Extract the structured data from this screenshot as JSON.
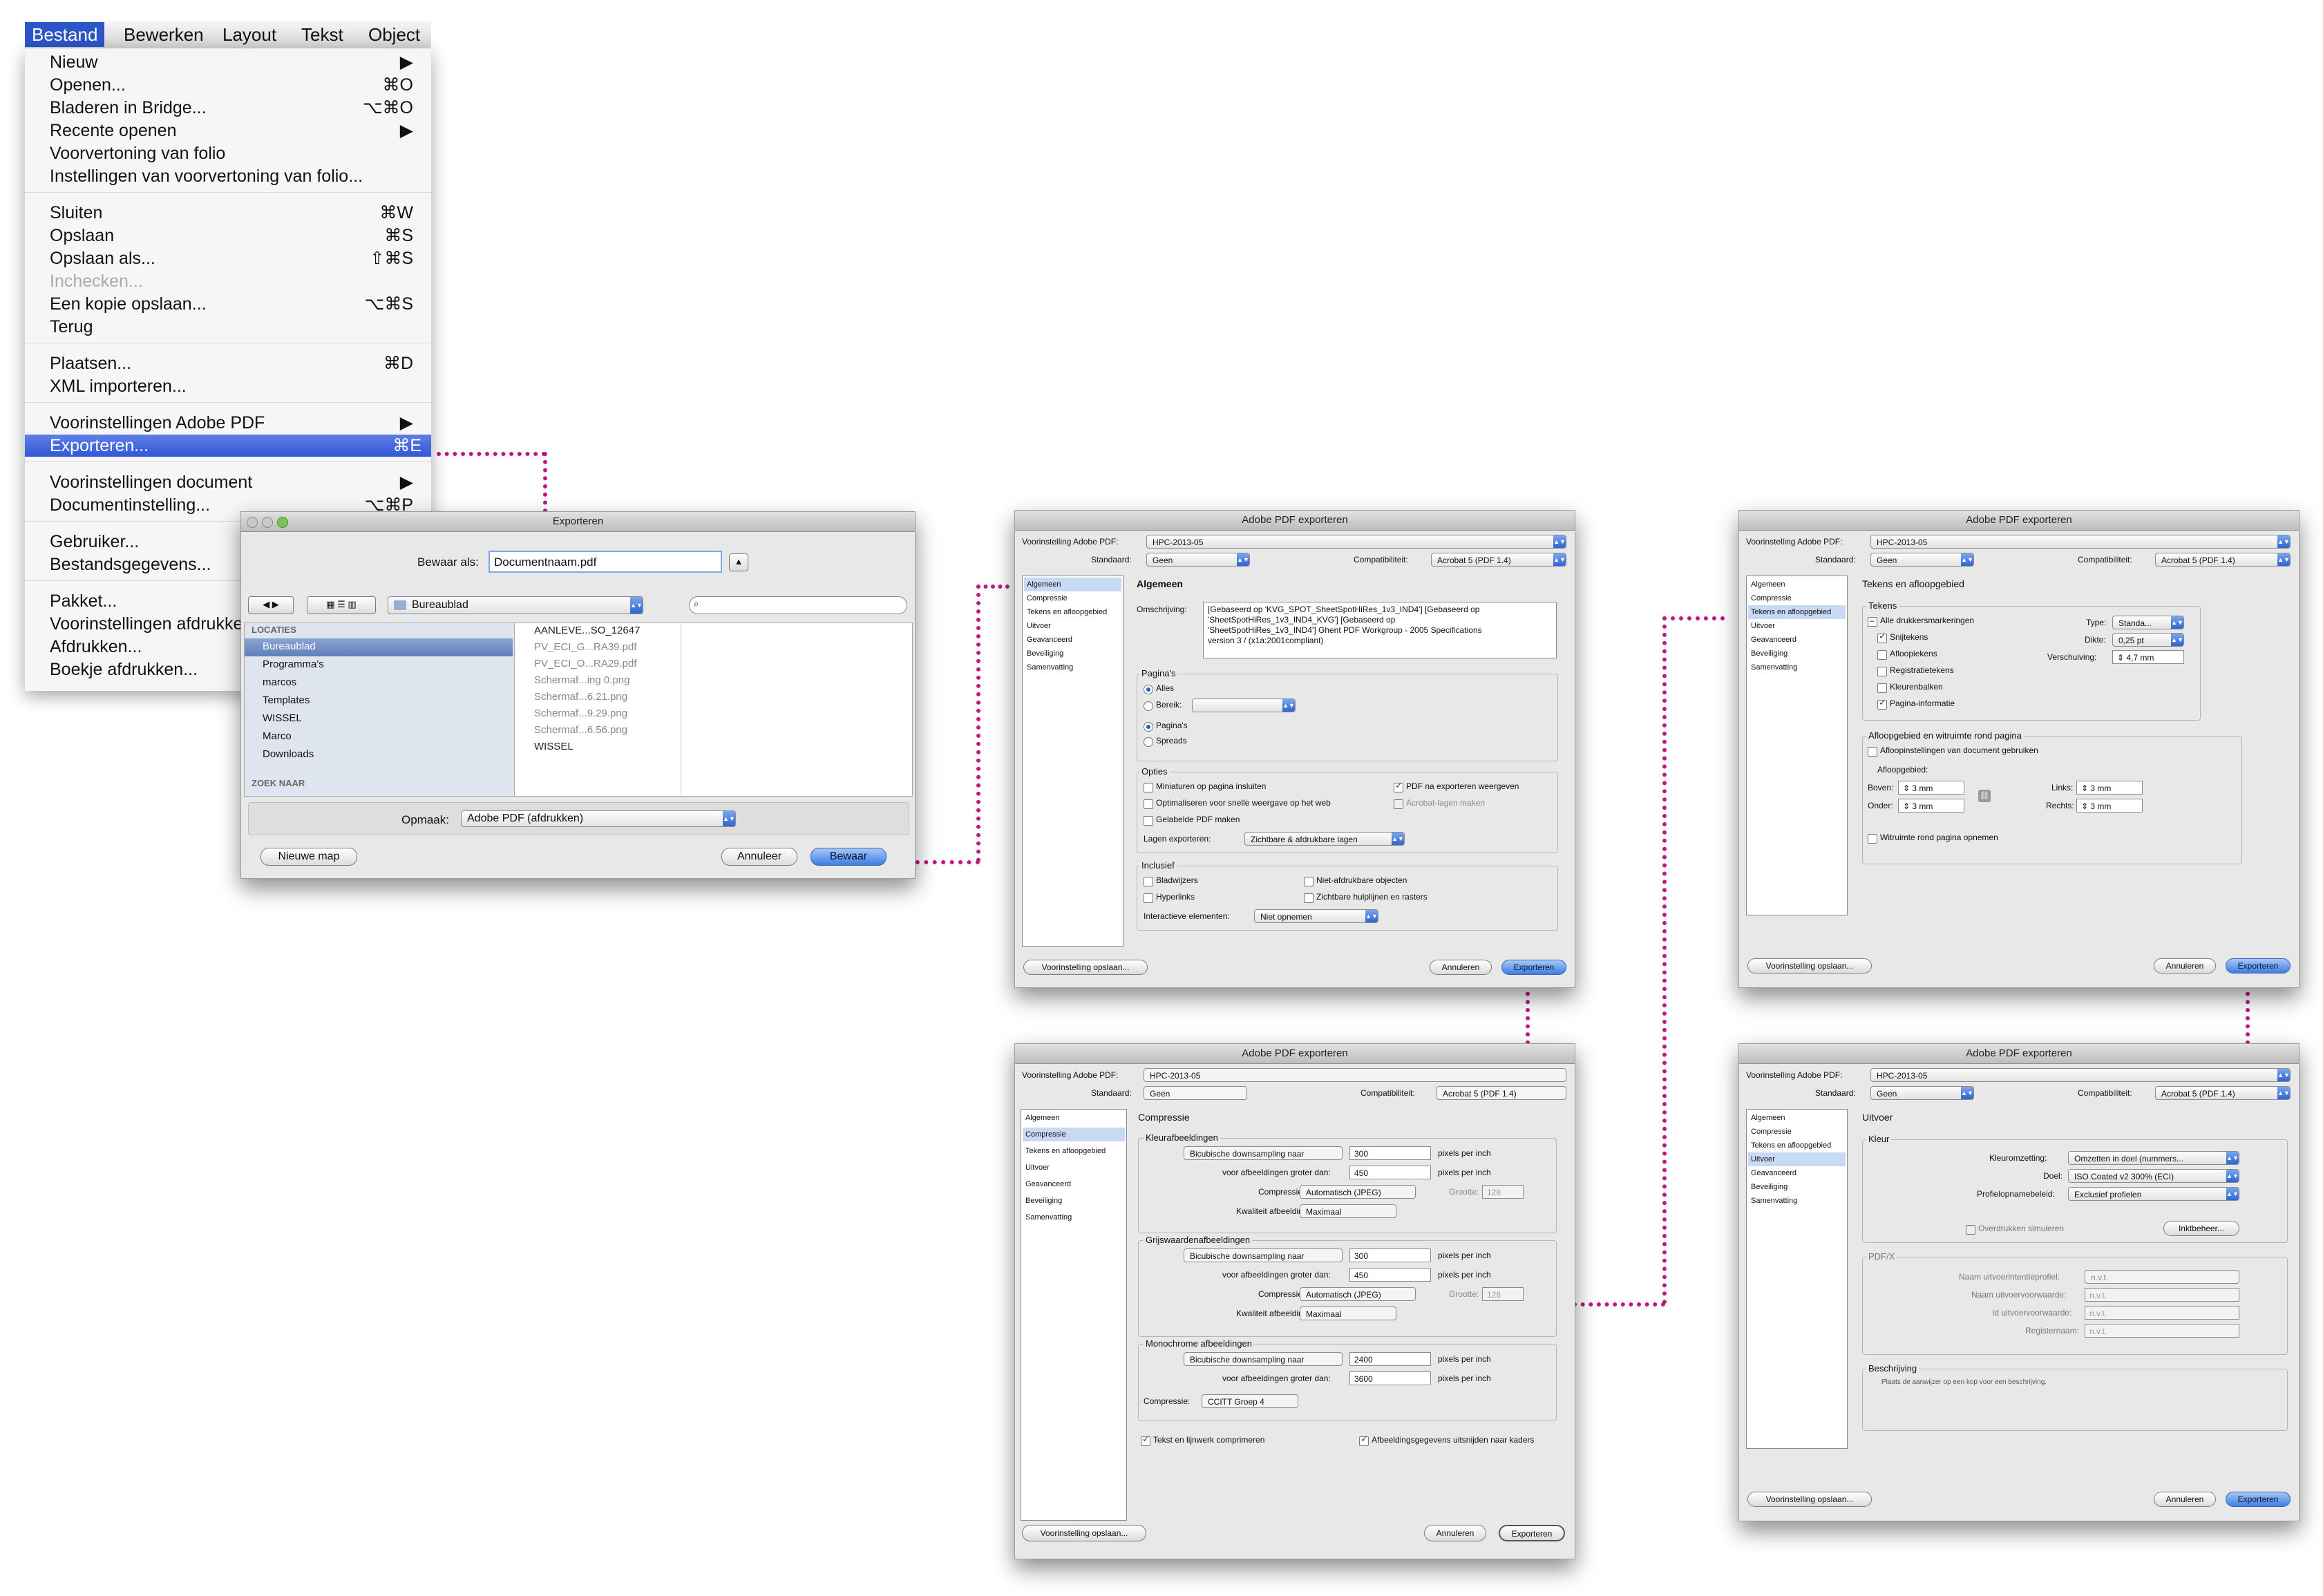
{
  "menubar": {
    "items": [
      "Bestand",
      "Bewerken",
      "Layout",
      "Tekst",
      "Object"
    ]
  },
  "file_menu": {
    "groups": [
      [
        {
          "label": "Nieuw",
          "shortcut": "▶"
        },
        {
          "label": "Openen...",
          "shortcut": "⌘O"
        },
        {
          "label": "Bladeren in Bridge...",
          "shortcut": "⌥⌘O"
        },
        {
          "label": "Recente openen",
          "shortcut": "▶"
        },
        {
          "label": "Voorvertoning van folio",
          "shortcut": ""
        },
        {
          "label": "Instellingen van voorvertoning van folio...",
          "shortcut": ""
        }
      ],
      [
        {
          "label": "Sluiten",
          "shortcut": "⌘W"
        },
        {
          "label": "Opslaan",
          "shortcut": "⌘S"
        },
        {
          "label": "Opslaan als...",
          "shortcut": "⇧⌘S"
        },
        {
          "label": "Inchecken...",
          "shortcut": ""
        },
        {
          "label": "Een kopie opslaan...",
          "shortcut": "⌥⌘S"
        },
        {
          "label": "Terug",
          "shortcut": ""
        }
      ],
      [
        {
          "label": "Plaatsen...",
          "shortcut": "⌘D"
        },
        {
          "label": "XML importeren...",
          "shortcut": ""
        }
      ],
      [
        {
          "label": "Voorinstellingen Adobe PDF",
          "shortcut": "▶"
        },
        {
          "label": "Exporteren...",
          "shortcut": "⌘E"
        }
      ],
      [
        {
          "label": "Voorinstellingen document",
          "shortcut": "▶"
        },
        {
          "label": "Documentinstelling...",
          "shortcut": "⌥⌘P"
        }
      ],
      [
        {
          "label": "Gebruiker...",
          "shortcut": ""
        },
        {
          "label": "Bestandsgegevens...",
          "shortcut": ""
        }
      ],
      [
        {
          "label": "Pakket...",
          "shortcut": ""
        },
        {
          "label": "Voorinstellingen afdrukken",
          "shortcut": ""
        },
        {
          "label": "Afdrukken...",
          "shortcut": ""
        },
        {
          "label": "Boekje afdrukken...",
          "shortcut": ""
        }
      ]
    ]
  },
  "save_dialog": {
    "title": "Exporteren",
    "save_as_label": "Bewaar als:",
    "filename": "Documentnaam.pdf",
    "location": "Bureaublad",
    "sidebar_heading": "LOCATIES",
    "sidebar_items": [
      "Bureaublad",
      "Programma's",
      "marcos",
      "Templates",
      "WISSEL",
      "Marco",
      "Downloads"
    ],
    "search_heading": "ZOEK NAAR",
    "files": [
      "AANLEVE...SO_12647",
      "PV_ECI_G...RA39.pdf",
      "PV_ECI_O...RA29.pdf",
      "Schermaf...ing 0.png",
      "Schermaf...6.21.png",
      "Schermaf...9.29.png",
      "Schermaf...6.56.png",
      "WISSEL"
    ],
    "format_label": "Opmaak:",
    "format_value": "Adobe PDF (afdrukken)",
    "new_folder": "Nieuwe map",
    "cancel": "Annuleer",
    "save": "Bewaar"
  },
  "pdf_common": {
    "title": "Adobe PDF exporteren",
    "preset_label": "Voorinstelling Adobe PDF:",
    "preset_value": "HPC-2013-05",
    "standard_label": "Standaard:",
    "standard_value": "Geen",
    "compat_label": "Compatibiliteit:",
    "compat_value": "Acrobat 5 (PDF 1.4)",
    "sidebar": [
      "Algemeen",
      "Compressie",
      "Tekens en afloopgebied",
      "Uitvoer",
      "Geavanceerd",
      "Beveiliging",
      "Samenvatting"
    ],
    "save_preset": "Voorinstelling opslaan...",
    "cancel": "Annuleren",
    "export": "Exporteren"
  },
  "general": {
    "heading": "Algemeen",
    "desc_label": "Omschrijving:",
    "desc_lines": [
      "[Gebaseerd op 'KVG_SPOT_SheetSpotHiRes_1v3_IND4'] [Gebaseerd op",
      "'SheetSpotHiRes_1v3_IND4_KVG'] [Gebaseerd op",
      "'SheetSpotHiRes_1v3_IND4'] Ghent PDF Workgroup - 2005 Specifications",
      "version 3 / (x1a:2001compliant)"
    ],
    "pages_group": "Pagina's",
    "all": "Alles",
    "range": "Bereik:",
    "pages": "Pagina's",
    "spreads": "Spreads",
    "options_group": "Opties",
    "thumbs": "Miniaturen op pagina insluiten",
    "fastweb": "Optimaliseren voor snelle weergave op het web",
    "tagged": "Gelabelde PDF maken",
    "view_after": "PDF na exporteren weergeven",
    "acro_layers": "Acrobat-lagen maken",
    "export_layers_label": "Lagen exporteren:",
    "export_layers_value": "Zichtbare & afdrukbare lagen",
    "include_group": "Inclusief",
    "bookmarks": "Bladwijzers",
    "hyperlinks": "Hyperlinks",
    "nonprint": "Niet-afdrukbare objecten",
    "guides": "Zichtbare hulplijnen en rasters",
    "interactive_label": "Interactieve elementen:",
    "interactive_value": "Niet opnemen"
  },
  "marks": {
    "heading": "Tekens en afloopgebied",
    "marks_group": "Tekens",
    "all_marks": "Alle drukkersmarkeringen",
    "crop": "Snijtekens",
    "bleed_marks": "Afloopiekens",
    "reg": "Registratietekens",
    "color_bars": "Kleurenbalken",
    "page_info": "Pagina-informatie",
    "type_label": "Type:",
    "type_value": "Standa...",
    "weight_label": "Dikte:",
    "weight_value": "0,25 pt",
    "offset_label": "Verschuiving:",
    "offset_value": "4,7 mm",
    "bleed_group": "Afloopgebied en witruimte rond pagina",
    "use_doc": "Afloopinstellingen van document gebruiken",
    "bleed_label": "Afloopgebied:",
    "top_label": "Boven:",
    "top_value": "3 mm",
    "bottom_label": "Onder:",
    "bottom_value": "3 mm",
    "left_label": "Links:",
    "left_value": "3 mm",
    "right_label": "Rechts:",
    "right_value": "3 mm",
    "slug": "Witruimte rond pagina opnemen"
  },
  "compression": {
    "heading": "Compressie",
    "color_group": "Kleurafbeeldingen",
    "gray_group": "Grijswaardenafbeeldingen",
    "mono_group": "Monochrome afbeeldingen",
    "resample": "Bicubische downsampling naar",
    "above_label": "voor afbeeldingen groter dan:",
    "ppi": "pixels per inch",
    "compression_label": "Compressie:",
    "auto_jpeg": "Automatisch (JPEG)",
    "quality_label": "Kwaliteit afbeelding:",
    "quality_value": "Maximaal",
    "tile_label": "Grootte:",
    "tile_value": "128",
    "color_res": "300",
    "color_above": "450",
    "gray_res": "300",
    "gray_above": "450",
    "mono_res": "2400",
    "mono_above": "3600",
    "mono_comp": "CCITT Groep 4",
    "compress_text": "Tekst en lijnwerk comprimeren",
    "crop_images": "Afbeeldingsgegevens uitsnijden naar kaders"
  },
  "output": {
    "heading": "Uitvoer",
    "color_group": "Kleur",
    "conv_label": "Kleuromzetting:",
    "conv_value": "Omzetten in doel (nummers...",
    "dest_label": "Doel:",
    "dest_value": "ISO Coated v2 300% (ECI)",
    "policy_label": "Profielopnamebeleid:",
    "policy_value": "Exclusief profielen",
    "simulate": "Overdrukken simuleren",
    "ink": "Inktbeheer...",
    "pdfx_group": "PDF/X",
    "intent_label": "Naam uitvoerintentieprofiel:",
    "cond_label": "Naam uitvoervoorwaarde:",
    "cond_id_label": "Id uitvoervoorwaarde:",
    "registry_label": "Registernaam:",
    "na": "n.v.t.",
    "desc_group": "Beschrijving",
    "desc_text": "Plaats de aanwijzer op een kop voor een beschrijving."
  }
}
